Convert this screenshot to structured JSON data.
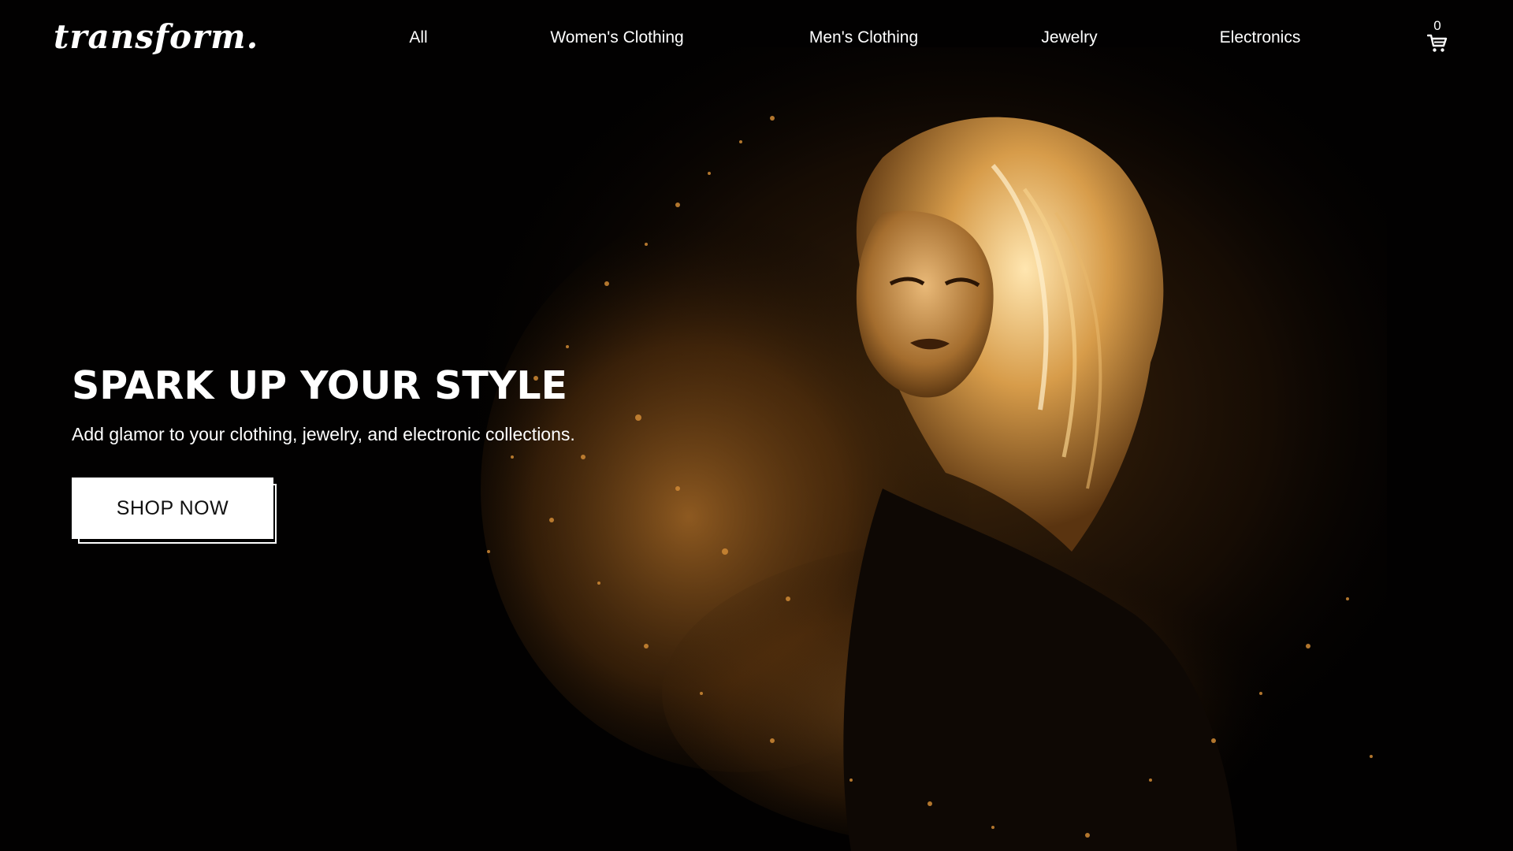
{
  "brand": {
    "logo_text": "transform."
  },
  "nav": {
    "items": [
      {
        "label": "All"
      },
      {
        "label": "Women's Clothing"
      },
      {
        "label": "Men's Clothing"
      },
      {
        "label": "Jewelry"
      },
      {
        "label": "Electronics"
      }
    ],
    "cart": {
      "count": "0",
      "icon": "cart-icon"
    }
  },
  "hero": {
    "title": "SPARK UP YOUR STYLE",
    "subtitle": "Add glamor to your clothing, jewelry, and electronic collections.",
    "cta_label": "SHOP NOW",
    "image": "woman-gold-particles-portrait"
  },
  "colors": {
    "background": "#000000",
    "text": "#ffffff",
    "accent_gold": "#c8862a",
    "button_bg": "#ffffff",
    "button_text": "#111111"
  }
}
